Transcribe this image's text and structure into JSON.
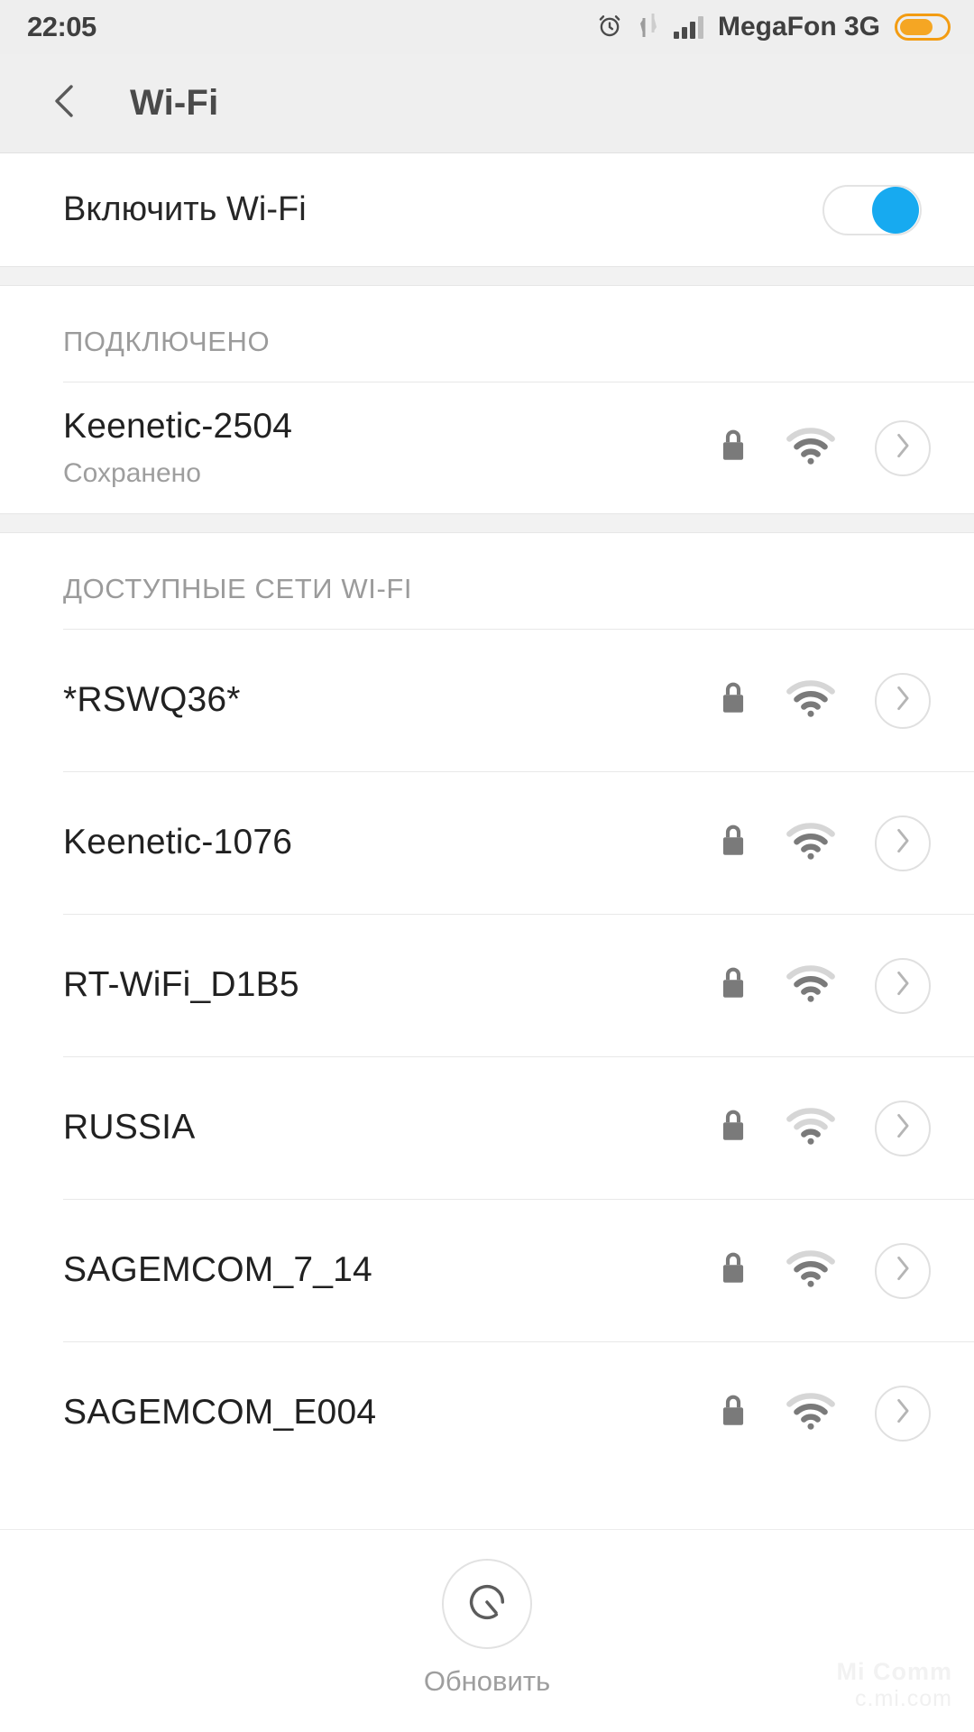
{
  "status_bar": {
    "time": "22:05",
    "alarm_icon": "alarm-clock-icon",
    "data_icon": "data-transfer-icon",
    "signal_icon": "cellular-signal-icon",
    "carrier": "MegaFon 3G",
    "battery_icon": "battery-icon",
    "battery_color": "#f5a623",
    "battery_level_percent": 72
  },
  "header": {
    "back_icon": "chevron-left-icon",
    "title": "Wi-Fi"
  },
  "toggle": {
    "label": "Включить Wi-Fi",
    "state": "on",
    "accent_color": "#17aaf0"
  },
  "connected_section": {
    "title": "ПОДКЛЮЧЕНО",
    "networks": [
      {
        "ssid": "Keenetic-2504",
        "status": "Сохранено",
        "lock_icon": "lock-icon",
        "wifi_icon": "wifi-signal-icon",
        "detail_icon": "chevron-right-icon",
        "signal_bars": 2
      }
    ]
  },
  "available_section": {
    "title": "ДОСТУПНЫЕ СЕТИ WI-FI",
    "networks": [
      {
        "ssid": "*RSWQ36*",
        "lock_icon": "lock-icon",
        "wifi_icon": "wifi-signal-icon",
        "detail_icon": "chevron-right-icon",
        "signal_bars": 2
      },
      {
        "ssid": "Keenetic-1076",
        "lock_icon": "lock-icon",
        "wifi_icon": "wifi-signal-icon",
        "detail_icon": "chevron-right-icon",
        "signal_bars": 2
      },
      {
        "ssid": "RT-WiFi_D1B5",
        "lock_icon": "lock-icon",
        "wifi_icon": "wifi-signal-icon",
        "detail_icon": "chevron-right-icon",
        "signal_bars": 2
      },
      {
        "ssid": "RUSSIA",
        "lock_icon": "lock-icon",
        "wifi_icon": "wifi-signal-icon",
        "detail_icon": "chevron-right-icon",
        "signal_bars": 1
      },
      {
        "ssid": "SAGEMCOM_7_14",
        "lock_icon": "lock-icon",
        "wifi_icon": "wifi-signal-icon",
        "detail_icon": "chevron-right-icon",
        "signal_bars": 2
      },
      {
        "ssid": "SAGEMCOM_E004",
        "lock_icon": "lock-icon",
        "wifi_icon": "wifi-signal-icon",
        "detail_icon": "chevron-right-icon",
        "signal_bars": 2
      }
    ]
  },
  "footer": {
    "refresh_icon": "refresh-scan-icon",
    "refresh_label": "Обновить"
  },
  "watermark": {
    "line1": "Mi Comm",
    "line2": "c.mi.com"
  }
}
